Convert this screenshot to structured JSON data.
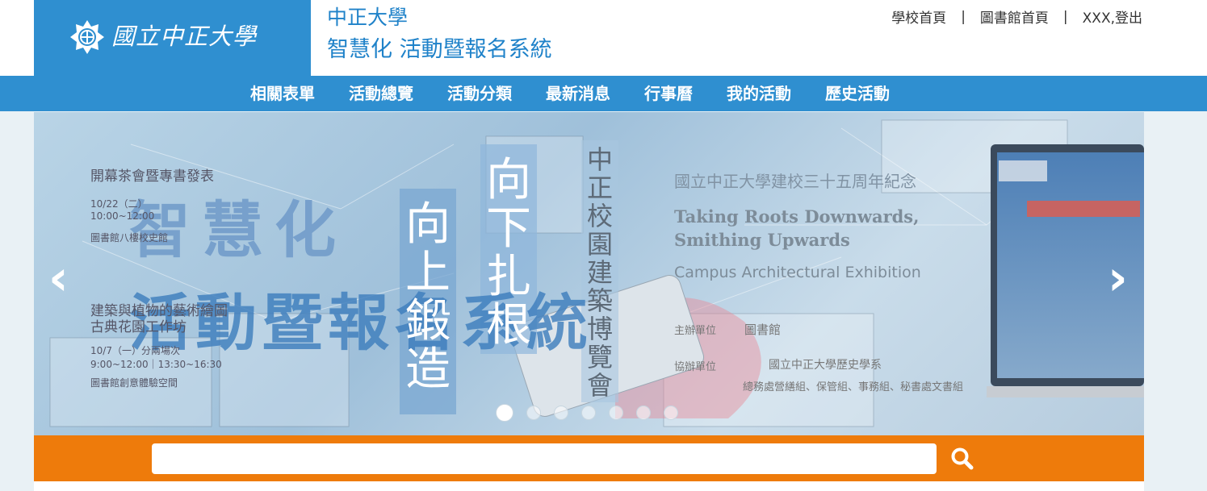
{
  "header": {
    "logo_text": "國立中正大學",
    "site_name": "中正大學",
    "system_name": "智慧化 活動暨報名系統",
    "links": [
      "學校首頁",
      "圖書館首頁",
      "XXX,登出"
    ],
    "separator": "|"
  },
  "nav": {
    "items": [
      "相關表單",
      "活動總覽",
      "活動分類",
      "最新消息",
      "行事曆",
      "我的活動",
      "歷史活動"
    ]
  },
  "banner": {
    "big_line1": "智慧化",
    "big_line2": "活動暨報名系統",
    "event1_title": "開幕茶會暨專書發表",
    "event1_date": "10/22（二）",
    "event1_time": "10:00~12:00",
    "event1_place": "圖書館八樓校史館",
    "event2_title_line1": "建築與植物的藝術繪圖",
    "event2_title_line2": "古典花園工作坊",
    "event2_date": "10/7（一）分兩場次",
    "event2_time": "9:00~12:00｜13:30~16:30",
    "event2_place": "圖書館創意體驗空間",
    "slogan1": "向上鍛造",
    "slogan2": "向下扎根",
    "slogan3": "中正校園建築博覽會",
    "anniversary": "國立中正大學建校三十五周年紀念",
    "en_line1": "Taking Roots Downwards,",
    "en_line2": "Smithing Upwards",
    "en_line3": "Campus Architectural Exhibition",
    "organizer_label": "主辦單位",
    "organizer": "圖書館",
    "co_organizer_label": "協辦單位",
    "co_organizer": "國立中正大學歷史學系",
    "co_organizer2": "總務處營繕組、保管組、事務組、秘書處文書組",
    "prev_arrow": "‹",
    "next_arrow": "›",
    "slide_count": 7,
    "active_slide": 1
  },
  "search": {
    "placeholder": "",
    "value": ""
  },
  "colors": {
    "primary": "#2f8fd0",
    "search_bar": "#ee7b0b",
    "title_text": "#1f82c9"
  }
}
